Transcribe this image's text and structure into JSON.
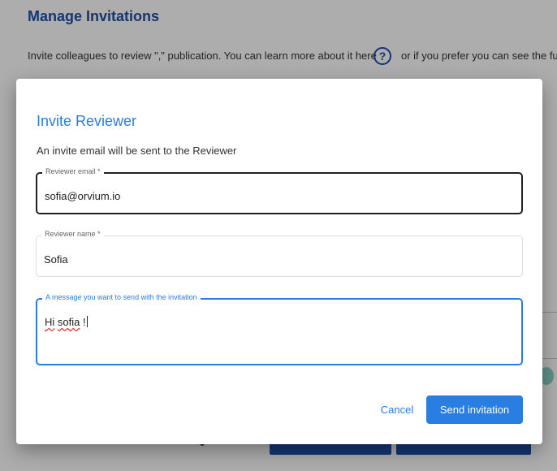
{
  "background": {
    "title": "Manage Invitations",
    "description": "Invite colleagues to review \",\" publication. You can learn more about it here",
    "help_icon": "?",
    "description_cont": "or if you prefer you can see the ful"
  },
  "dialog": {
    "title": "Invite Reviewer",
    "subtitle": "An invite email will be sent to the Reviewer",
    "email_field": {
      "label": "Reviewer email *",
      "value": "sofia@orvium.io"
    },
    "name_field": {
      "label": "Reviewer name *",
      "value": "Sofia"
    },
    "message_field": {
      "label": "A message you want to send with the invitation",
      "value_word1": "Hi",
      "value_word2": "sofia",
      "value_word3": "!"
    },
    "cancel_label": "Cancel",
    "send_label": "Send invitation"
  },
  "colors": {
    "accent": "#2a7de1",
    "background_title": "#1e4fa8",
    "overlay": "rgba(0,0,0,0.32)"
  }
}
